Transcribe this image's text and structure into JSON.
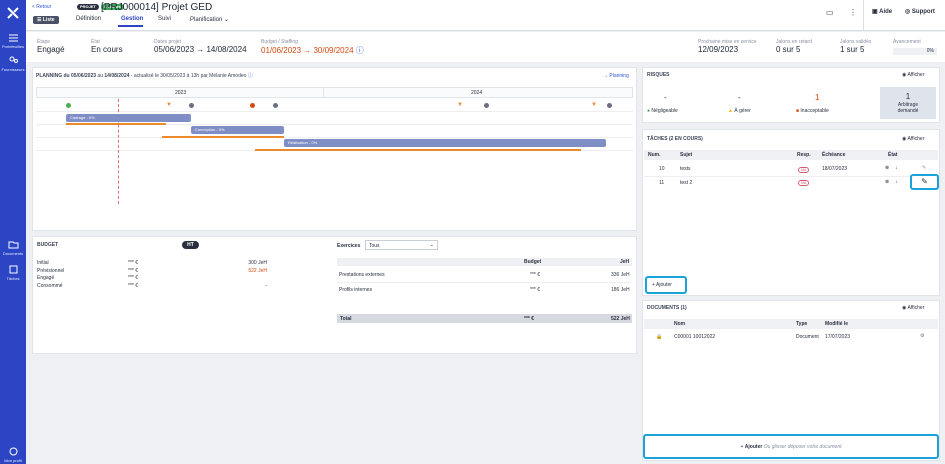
{
  "sidebar": {
    "items": [
      {
        "label": "Portefeuilles"
      },
      {
        "label": "Fournisseurs"
      },
      {
        "label": "Documents"
      },
      {
        "label": "Tâches"
      },
      {
        "label": "Mon profil"
      }
    ]
  },
  "header": {
    "back": "< Retour",
    "badge_projet": "PROJET",
    "badge_status": "En cours",
    "title": "[PRJ000014] Projet GED",
    "liste": "Liste",
    "tabs": [
      "Définition",
      "Gestion",
      "Suivi",
      "Planification"
    ],
    "aide": "Aide",
    "support": "Support"
  },
  "info": {
    "etape_label": "Étape",
    "etape": "Engagé",
    "etat_label": "État",
    "etat": "En cours",
    "dates_label": "Dates projet",
    "dates": "05/06/2023 → 14/08/2024",
    "budget_label": "Budget / Staffing",
    "budget": "01/06/2023 → 30/09/2024",
    "prochaine_label": "Prochaine mise en service",
    "prochaine": "12/09/2023",
    "retard_label": "Jalons en retard",
    "retard": "0 sur 5",
    "valides_label": "Jalons validés",
    "valides": "1 sur 5",
    "avancement_label": "Avancement",
    "avancement": "0%"
  },
  "planning": {
    "title_prefix": "PLANNING du",
    "start": "05/06/2023",
    "mid": "au",
    "end": "14/08/2024",
    "suffix": "- actualisé le 30/05/2023 à 13h par Mélanie Amodeo",
    "link": "→ Planning",
    "years": [
      "2023",
      "2024"
    ],
    "bars": [
      {
        "label": "Cadrage - 0%"
      },
      {
        "label": "Conception - 0%"
      },
      {
        "label": "Réalisation - 0%"
      }
    ]
  },
  "budget": {
    "title": "BUDGET",
    "toggle": "HT",
    "rows": [
      {
        "label": "Initial",
        "value": "*** €",
        "jeh": "300 JeH"
      },
      {
        "label": "Prévisionnel",
        "value": "*** €",
        "jeh": "522 JeH"
      },
      {
        "label": "Engagé",
        "value": "*** €",
        "jeh": ""
      },
      {
        "label": "Consommé",
        "value": "*** €",
        "jeh": "-"
      }
    ],
    "exercices_label": "Exercices",
    "exercices_value": "Tous",
    "table_headers": [
      "Budget",
      "JeH"
    ],
    "table_rows": [
      {
        "label": "Prestations externes",
        "budget": "*** €",
        "jeh": "336 JeH"
      },
      {
        "label": "Profils internes",
        "budget": "*** €",
        "jeh": "186 JeH"
      }
    ],
    "total": {
      "label": "Total",
      "budget": "*** €",
      "jeh": "522 JeH"
    }
  },
  "risques": {
    "title": "RISQUES",
    "afficher": "Afficher",
    "cells": [
      {
        "value": "-",
        "label": "Négligeable"
      },
      {
        "value": "-",
        "label": "À gérer"
      },
      {
        "value": "1",
        "label": "Inacceptable"
      },
      {
        "value": "1",
        "label": "Arbitrage demandé"
      }
    ]
  },
  "taches": {
    "title": "TÂCHES (2 EN COURS)",
    "afficher": "Afficher",
    "headers": [
      "Num.",
      "Sujet",
      "Resp.",
      "Échéance",
      "État"
    ],
    "rows": [
      {
        "num": "10",
        "sujet": "tests",
        "resp": "MA",
        "echeance": "18/07/2023"
      },
      {
        "num": "11",
        "sujet": "test 2",
        "resp": "MA",
        "echeance": ""
      }
    ],
    "ajouter": "Ajouter"
  },
  "documents": {
    "title": "DOCUMENTS (1)",
    "afficher": "Afficher",
    "headers": [
      "Nom",
      "Type",
      "Modifié le"
    ],
    "rows": [
      {
        "nom": "C00001 10012022",
        "type": "Document",
        "modifie": "17/07/2023"
      }
    ],
    "ajouter": "Ajouter",
    "drop": "Ou glisser déposer votre document"
  }
}
